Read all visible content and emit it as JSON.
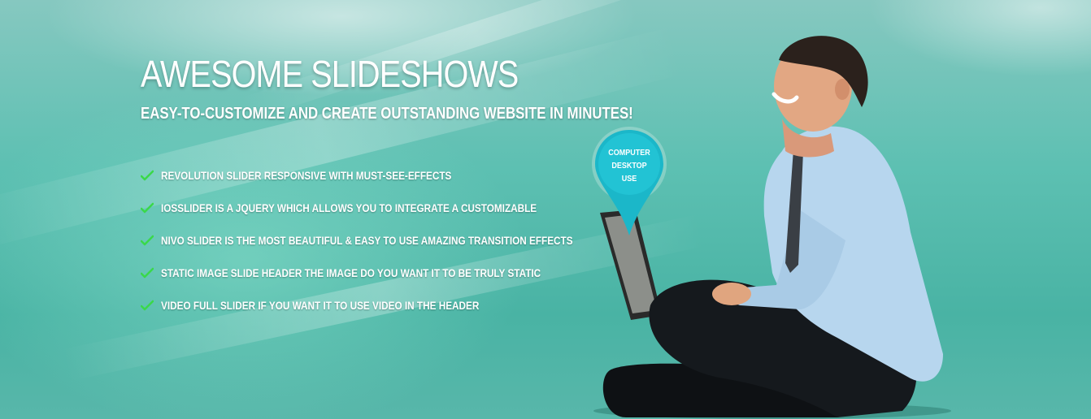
{
  "hero": {
    "title": "AWESOME SLIDESHOWS",
    "subtitle": "EASY-TO-CUSTOMIZE AND CREATE OUTSTANDING WEBSITE IN MINUTES!",
    "features": [
      "REVOLUTION SLIDER RESPONSIVE WITH MUST-SEE-EFFECTS",
      "IOSSLIDER IS A JQUERY WHICH ALLOWS YOU TO INTEGRATE A CUSTOMIZABLE",
      "NIVO SLIDER IS THE MOST BEAUTIFUL & EASY TO USE AMAZING TRANSITION EFFECTS",
      "STATIC IMAGE SLIDE HEADER THE IMAGE DO YOU WANT IT TO BE TRULY STATIC",
      "VIDEO FULL SLIDER IF YOU WANT IT TO USE VIDEO IN THE HEADER"
    ],
    "check_icon": "checkmark-icon",
    "check_color": "#3ad84a"
  },
  "pin": {
    "line1": "COMPUTER",
    "line2": "DESKTOP",
    "line3": "USE",
    "color": "#1bb7c9"
  },
  "colors": {
    "background": "#5dc0b2",
    "text": "#ffffff"
  }
}
